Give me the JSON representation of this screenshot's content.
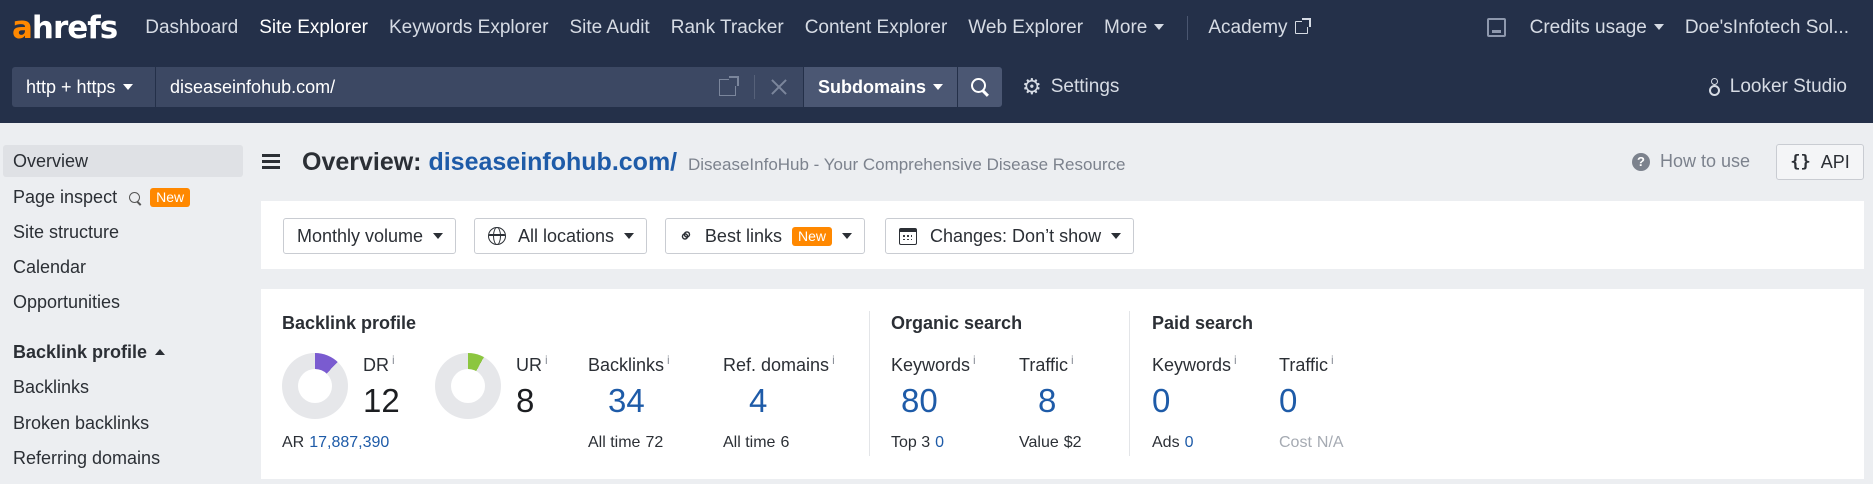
{
  "colors": {
    "nav_bg": "#243049",
    "brand_orange": "#ff8800",
    "link_blue": "#1e5ba8",
    "dr_purple": "#7a5bd0",
    "ur_green": "#8cc63f"
  },
  "topnav": {
    "logo_a": "a",
    "logo_rest": "hrefs",
    "items": [
      {
        "label": "Dashboard"
      },
      {
        "label": "Site Explorer"
      },
      {
        "label": "Keywords Explorer"
      },
      {
        "label": "Site Audit"
      },
      {
        "label": "Rank Tracker"
      },
      {
        "label": "Content Explorer"
      },
      {
        "label": "Web Explorer"
      },
      {
        "label": "More"
      }
    ],
    "academy": "Academy",
    "credits": "Credits usage",
    "account": "Doe'sInfotech Sol..."
  },
  "search": {
    "protocol": "http + https",
    "url": "diseaseinfohub.com/",
    "mode": "Subdomains",
    "settings": "Settings",
    "looker": "Looker Studio"
  },
  "sidebar": {
    "items": [
      {
        "label": "Overview"
      },
      {
        "label": "Page inspect",
        "badge": "New"
      },
      {
        "label": "Site structure"
      },
      {
        "label": "Calendar"
      },
      {
        "label": "Opportunities"
      }
    ],
    "section": "Backlink profile",
    "section_items": [
      {
        "label": "Backlinks"
      },
      {
        "label": "Broken backlinks"
      },
      {
        "label": "Referring domains"
      }
    ]
  },
  "header": {
    "title_prefix": "Overview:",
    "title_domain": "diseaseinfohub.com/",
    "subtitle": "DiseaseInfoHub - Your Comprehensive Disease Resource",
    "how_to_use": "How to use",
    "api": "API"
  },
  "filters": {
    "volume": "Monthly volume",
    "locations": "All locations",
    "links": "Best links",
    "links_badge": "New",
    "changes": "Changes: Don’t show"
  },
  "metrics": {
    "backlink_profile": {
      "heading": "Backlink profile",
      "dr_label": "DR",
      "dr_value": "12",
      "dr_fill_pct": 12,
      "ar_label": "AR",
      "ar_value": "17,887,390",
      "ur_label": "UR",
      "ur_value": "8",
      "ur_fill_pct": 8,
      "backlinks_label": "Backlinks",
      "backlinks_value": "34",
      "backlinks_alltime_label": "All time",
      "backlinks_alltime_value": "72",
      "refdomains_label": "Ref. domains",
      "refdomains_value": "4",
      "refdomains_alltime_label": "All time",
      "refdomains_alltime_value": "6"
    },
    "organic": {
      "heading": "Organic search",
      "keywords_label": "Keywords",
      "keywords_value": "80",
      "top3_label": "Top 3",
      "top3_value": "0",
      "traffic_label": "Traffic",
      "traffic_value": "8",
      "value_label": "Value",
      "value_value": "$2"
    },
    "paid": {
      "heading": "Paid search",
      "keywords_label": "Keywords",
      "keywords_value": "0",
      "ads_label": "Ads",
      "ads_value": "0",
      "traffic_label": "Traffic",
      "traffic_value": "0",
      "cost_label": "Cost",
      "cost_value": "N/A"
    },
    "info_mark": "i"
  }
}
